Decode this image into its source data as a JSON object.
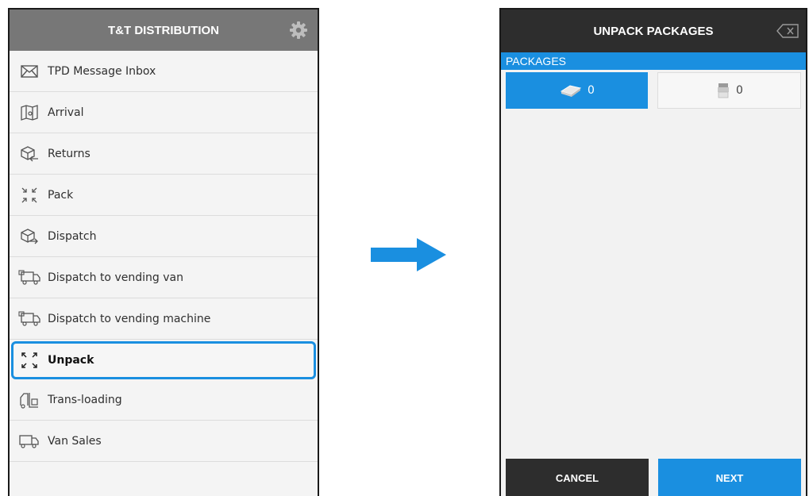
{
  "left_screen": {
    "title": "T&T DISTRIBUTION",
    "settings_icon": "gear-icon",
    "menu": [
      {
        "label": "TPD Message Inbox",
        "icon": "envelope-icon"
      },
      {
        "label": "Arrival",
        "icon": "map-pin-icon"
      },
      {
        "label": "Returns",
        "icon": "box-return-icon"
      },
      {
        "label": "Pack",
        "icon": "collapse-arrows-icon"
      },
      {
        "label": "Dispatch",
        "icon": "box-dispatch-icon"
      },
      {
        "label": "Dispatch to vending van",
        "icon": "van-icon"
      },
      {
        "label": "Dispatch to vending machine",
        "icon": "van-icon"
      },
      {
        "label": "Unpack",
        "icon": "expand-arrows-icon",
        "selected": true
      },
      {
        "label": "Trans-loading",
        "icon": "forklift-icon"
      },
      {
        "label": "Van Sales",
        "icon": "truck-icon"
      }
    ]
  },
  "right_screen": {
    "title": "UNPACK PACKAGES",
    "back_icon": "backspace-icon",
    "section_label": "PACKAGES",
    "tiles": [
      {
        "count": "0",
        "icon": "cigarette-pack-icon",
        "active": true
      },
      {
        "count": "0",
        "icon": "package-icon",
        "active": false
      }
    ],
    "cancel_label": "CANCEL",
    "next_label": "NEXT"
  },
  "colors": {
    "accent": "#1a8fe0",
    "left_header": "#777777",
    "right_header": "#2d2d2d"
  }
}
